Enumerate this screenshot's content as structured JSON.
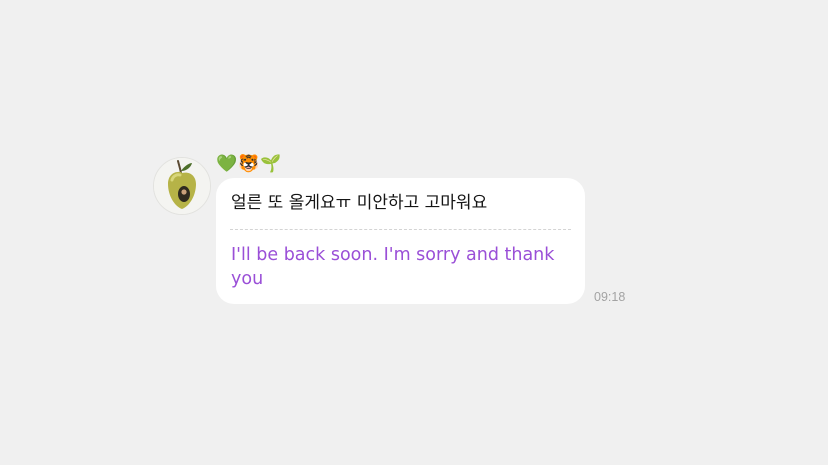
{
  "message": {
    "avatar_icon": "apple-avatar-icon",
    "sender_name": "💚🐯🌱",
    "original_text": "얼른 또 올게요ㅠ 미안하고 고마워요",
    "translated_text": "I'll be back soon. I'm sorry and thank you",
    "timestamp": "09:18"
  },
  "colors": {
    "background": "#f0f0f0",
    "bubble": "#ffffff",
    "translation": "#9a4fd7",
    "timestamp": "#a3a3a3"
  }
}
